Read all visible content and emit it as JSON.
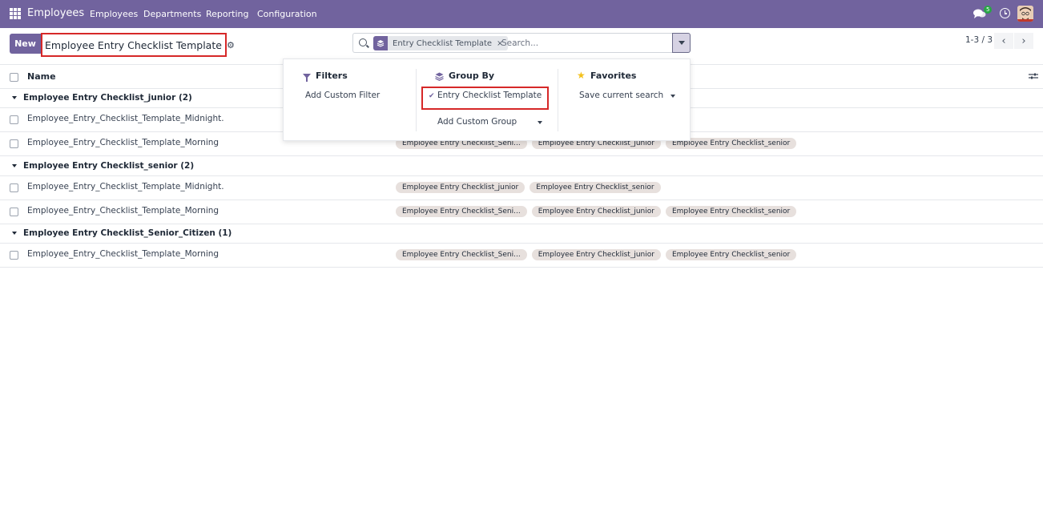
{
  "navbar": {
    "app_name": "Employees",
    "menu": [
      "Employees",
      "Departments",
      "Reporting",
      "Configuration"
    ],
    "chat_count": "5",
    "bg_color": "#71639e"
  },
  "control": {
    "new_label": "New",
    "breadcrumb": "Employee Entry Checklist Template",
    "search_facet": "Entry Checklist Template",
    "search_placeholder": "Search...",
    "pager": "1-3 / 3"
  },
  "list": {
    "column_name": "Name",
    "groups": [
      {
        "label": "Employee Entry Checklist_junior (2)",
        "rows": [
          {
            "name": "Employee_Entry_Checklist_Template_Midnight.",
            "tags": []
          },
          {
            "name": "Employee_Entry_Checklist_Template_Morning",
            "tags": [
              "Employee Entry Checklist_Seni...",
              "Employee Entry Checklist_junior",
              "Employee Entry Checklist_senior"
            ]
          }
        ]
      },
      {
        "label": "Employee Entry Checklist_senior (2)",
        "rows": [
          {
            "name": "Employee_Entry_Checklist_Template_Midnight.",
            "tags": [
              "Employee Entry Checklist_junior",
              "Employee Entry Checklist_senior"
            ]
          },
          {
            "name": "Employee_Entry_Checklist_Template_Morning",
            "tags": [
              "Employee Entry Checklist_Seni...",
              "Employee Entry Checklist_junior",
              "Employee Entry Checklist_senior"
            ]
          }
        ]
      },
      {
        "label": "Employee Entry Checklist_Senior_Citizen (1)",
        "rows": [
          {
            "name": "Employee_Entry_Checklist_Template_Morning",
            "tags": [
              "Employee Entry Checklist_Seni...",
              "Employee Entry Checklist_junior",
              "Employee Entry Checklist_senior"
            ]
          }
        ]
      }
    ]
  },
  "dropdown": {
    "filters_title": "Filters",
    "add_custom_filter": "Add Custom Filter",
    "groupby_title": "Group By",
    "groupby_selected": "Entry Checklist Template",
    "add_custom_group": "Add Custom Group",
    "favorites_title": "Favorites",
    "save_current_search": "Save current search"
  }
}
